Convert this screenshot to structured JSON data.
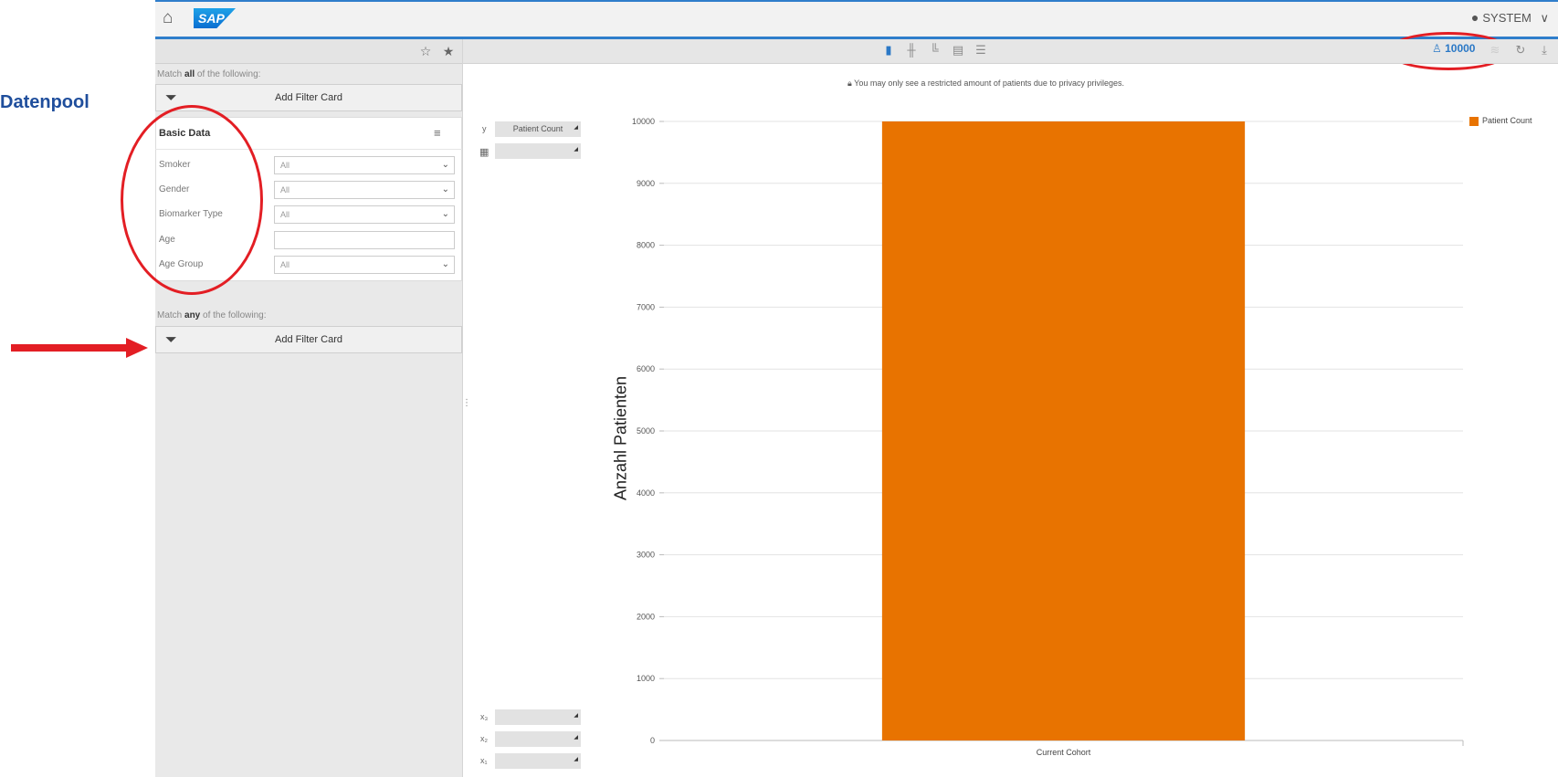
{
  "shell": {
    "home_icon": "home-icon",
    "logo_text": "SAP",
    "user_name": "SYSTEM",
    "user_chevron": "∨"
  },
  "annotations": {
    "side_label": "Datenpool",
    "accent_color": "#e31e24",
    "side_label_color": "#1f4e9c"
  },
  "left_panel": {
    "match_all_prefix": "Match ",
    "match_all_bold": "all",
    "match_all_suffix": " of the following:",
    "match_any_prefix": "Match ",
    "match_any_bold": "any",
    "match_any_suffix": " of the following:",
    "add_filter_card": "Add Filter Card",
    "card": {
      "title": "Basic Data",
      "rows": [
        {
          "label": "Smoker",
          "value": "All",
          "type": "select"
        },
        {
          "label": "Gender",
          "value": "All",
          "type": "select"
        },
        {
          "label": "Biomarker Type",
          "value": "All",
          "type": "select"
        },
        {
          "label": "Age",
          "value": "",
          "type": "input"
        },
        {
          "label": "Age Group",
          "value": "All",
          "type": "select"
        }
      ]
    }
  },
  "main": {
    "patient_count_badge": "10000",
    "privacy_notice": "You may only see a restricted amount of patients due to privacy privileges.",
    "y_axis_prefix": "y",
    "y_axis_select": "Patient Count",
    "x_axis_labels": [
      "x₃",
      "x₂",
      "x₁"
    ]
  },
  "chart_data": {
    "type": "bar",
    "categories": [
      "Current Cohort"
    ],
    "series": [
      {
        "name": "Patient Count",
        "values": [
          10000
        ],
        "color": "#e87300"
      }
    ],
    "ylabel": "Anzahl Patienten",
    "ylim": [
      0,
      10000
    ],
    "yticks": [
      0,
      1000,
      2000,
      3000,
      4000,
      5000,
      6000,
      7000,
      8000,
      9000,
      10000
    ],
    "grid": true,
    "legend_position": "top-right"
  }
}
